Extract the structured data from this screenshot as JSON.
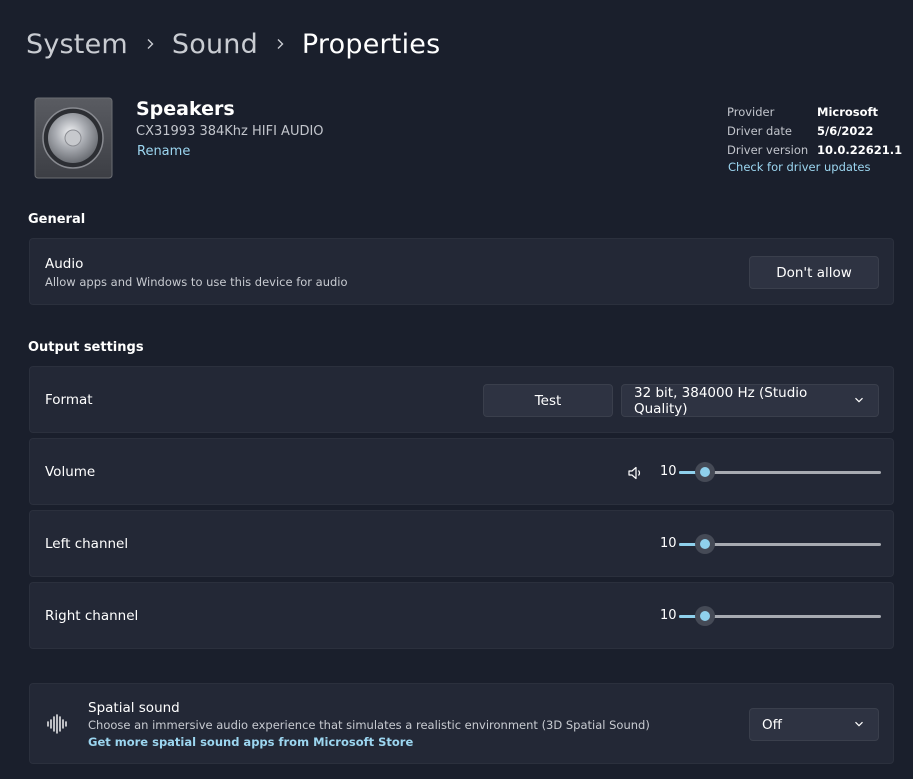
{
  "breadcrumb": [
    "System",
    "Sound",
    "Properties"
  ],
  "device": {
    "name": "Speakers",
    "model": "CX31993 384Khz HIFI AUDIO",
    "rename_label": "Rename"
  },
  "driver": {
    "rows": [
      {
        "key": "Provider",
        "value": "Microsoft"
      },
      {
        "key": "Driver date",
        "value": "5/6/2022"
      },
      {
        "key": "Driver version",
        "value": "10.0.22621.1"
      }
    ],
    "update_link": "Check for driver updates"
  },
  "general": {
    "title": "General",
    "audio": {
      "label": "Audio",
      "description": "Allow apps and Windows to use this device for audio",
      "button": "Don't allow"
    }
  },
  "output": {
    "title": "Output settings",
    "format": {
      "label": "Format",
      "test_button": "Test",
      "selected": "32 bit, 384000 Hz (Studio Quality)"
    },
    "volume": {
      "label": "Volume",
      "value": "10",
      "fraction": 0.13
    },
    "left": {
      "label": "Left channel",
      "value": "10",
      "fraction": 0.13
    },
    "right": {
      "label": "Right channel",
      "value": "10",
      "fraction": 0.13
    }
  },
  "spatial": {
    "label": "Spatial sound",
    "description": "Choose an immersive audio experience that simulates a realistic environment (3D Spatial Sound)",
    "link": "Get more spatial sound apps from Microsoft Store",
    "selected": "Off"
  },
  "colors": {
    "background": "#1a1f2c",
    "card": "#232836",
    "accent": "#8fd0ec",
    "link": "#9cd6f0"
  }
}
